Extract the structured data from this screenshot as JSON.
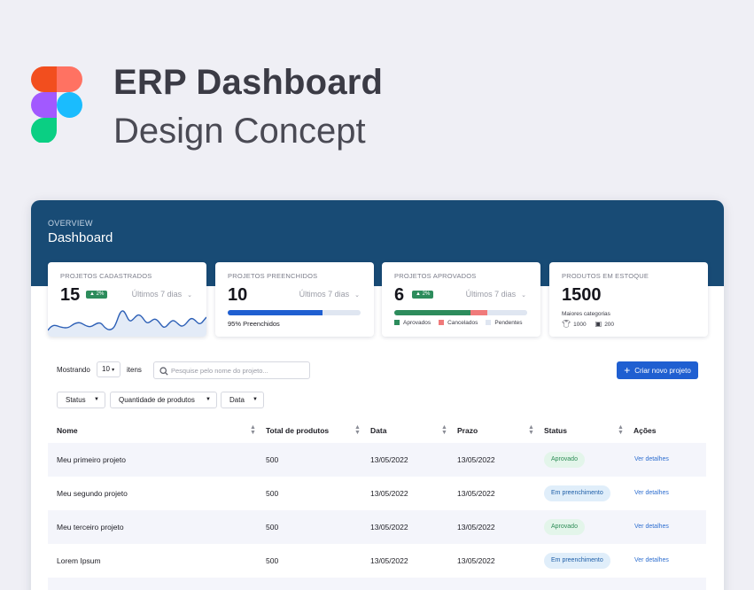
{
  "hero": {
    "title": "ERP Dashboard",
    "subtitle": "Design Concept"
  },
  "header": {
    "overline": "OVERVIEW",
    "title": "Dashboard"
  },
  "cards": [
    {
      "title": "PROJETOS CADASTRADOS",
      "value": "15",
      "badge": "▲ 2%",
      "period": "Últimos 7 dias"
    },
    {
      "title": "PROJETOS PREENCHIDOS",
      "value": "10",
      "period": "Últimos 7 dias",
      "progress": 0.71,
      "progress_label": "95% Preenchidos"
    },
    {
      "title": "PROJETOS APROVADOS",
      "value": "6",
      "badge": "▲ 2%",
      "period": "Últimos 7 dias",
      "segments": [
        {
          "name": "Aprovados",
          "fraction": 0.57,
          "color": "#2d8c5c"
        },
        {
          "name": "Cancelados",
          "fraction": 0.13,
          "color": "#f07a7a"
        },
        {
          "name": "Pendentes",
          "fraction": 0.3,
          "color": "#dfe6f1"
        }
      ]
    },
    {
      "title": "PRODUTOS EM ESTOQUE",
      "value": "1500",
      "categories_label": "Maiores categorias",
      "categories": [
        {
          "icon": "tshirt-icon",
          "value": "1000"
        },
        {
          "icon": "chip-icon",
          "value": "200"
        }
      ]
    }
  ],
  "toolbar": {
    "showing": "Mostrando",
    "page_size": "10",
    "items": "itens",
    "search_placeholder": "Pesquise pelo nome do projeto...",
    "create_button": "Criar novo projeto"
  },
  "filters": [
    "Status",
    "Quantidade de produtos",
    "Data"
  ],
  "table": {
    "columns": [
      "Nome",
      "Total de produtos",
      "Data",
      "Prazo",
      "Status",
      "Ações"
    ],
    "rows": [
      {
        "name": "Meu primeiro projeto",
        "total": "500",
        "date": "13/05/2022",
        "deadline": "13/05/2022",
        "status": "Aprovado",
        "status_type": "ok",
        "action": "Ver detalhes"
      },
      {
        "name": "Meu segundo projeto",
        "total": "500",
        "date": "13/05/2022",
        "deadline": "13/05/2022",
        "status": "Em preenchimento",
        "status_type": "fill",
        "action": "Ver detalhes"
      },
      {
        "name": "Meu terceiro projeto",
        "total": "500",
        "date": "13/05/2022",
        "deadline": "13/05/2022",
        "status": "Aprovado",
        "status_type": "ok",
        "action": "Ver detalhes"
      },
      {
        "name": "Lorem Ipsum",
        "total": "500",
        "date": "13/05/2022",
        "deadline": "13/05/2022",
        "status": "Em preenchimento",
        "status_type": "fill",
        "action": "Ver detalhes"
      }
    ]
  },
  "colors": {
    "header": "#184b75",
    "primary": "#1f5fd1",
    "approved": "#2d8c5c",
    "cancelled": "#f07a7a"
  }
}
